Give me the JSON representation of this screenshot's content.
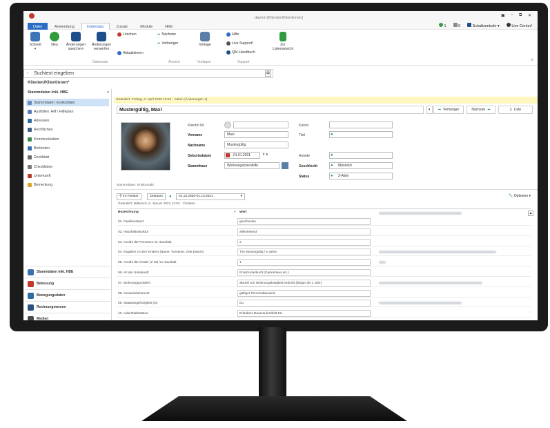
{
  "window": {
    "title": "daenin [Klienten/Klientinnen]"
  },
  "menu_tabs": [
    "Datei",
    "Anwendung",
    "Datensatz",
    "Zusatz",
    "Module",
    "Hilfe"
  ],
  "active_tab": "Datensatz",
  "top_right": {
    "count_a": "1",
    "count_b": "0",
    "schaltzentrale": "Schaltzentrale",
    "live_center": "Live Center!"
  },
  "ribbon": {
    "schnell": "Schnell",
    "neu": "Neu",
    "save": [
      "Änderungen",
      "speichern"
    ],
    "discard": [
      "Änderungen",
      "verwerfen"
    ],
    "loeschen": "Löschen",
    "aktualisieren": "Aktualisieren",
    "naechster": "Nächster",
    "vorheriger": "Vorheriger",
    "vorlage": "Vorlage",
    "hilfe": "Hilfe",
    "live_support": "Live Support!",
    "qm_handbuch": "QM-Handbuch",
    "zur_liste": [
      "Zur",
      "Listenansicht"
    ],
    "groups": {
      "datensatz": "Datensatz",
      "ansicht": "Ansicht",
      "vorlagen": "Vorlagen",
      "support": "Support"
    }
  },
  "search": {
    "text": "Suchtext eingeben"
  },
  "breadcrumb": "Klienten/Klientinnen*",
  "sidebar": {
    "header": "Stammdaten inkl. HBE",
    "items": [
      {
        "label": "Stammdaten: Erstkontakt",
        "icon": "people-icon",
        "color": "#6c8ab8"
      },
      {
        "label": "Ausfüllen: Hilf / Hilfeplan",
        "icon": "document-icon",
        "color": "#5a7fb5"
      },
      {
        "label": "Adressen",
        "icon": "address-icon",
        "color": "#2e6ca4"
      },
      {
        "label": "Rechtliches",
        "icon": "law-icon",
        "color": "#3f5f8a"
      },
      {
        "label": "Kommunikation",
        "icon": "phone-icon",
        "color": "#3b8a4a"
      },
      {
        "label": "Behörden",
        "icon": "authority-icon",
        "color": "#3a6fb0"
      },
      {
        "label": "Deckblatt",
        "icon": "sheet-icon",
        "color": "#6a6a6a"
      },
      {
        "label": "Checklisten",
        "icon": "checklist-icon",
        "color": "#7a7a7a"
      },
      {
        "label": "Unterkunft",
        "icon": "house-icon",
        "color": "#b73a2f"
      },
      {
        "label": "Bemerkung",
        "icon": "note-icon",
        "color": "#d9a52a"
      }
    ],
    "modules": [
      {
        "label": "Stammdaten inkl. HBE",
        "icon": "stammdaten-icon",
        "color": "#3a6fb0"
      },
      {
        "label": "Betreuung",
        "icon": "book-icon",
        "color": "#c0392b"
      },
      {
        "label": "Bewegungsdaten",
        "icon": "arrows-icon",
        "color": "#2e6ca4"
      },
      {
        "label": "Rechnungswesen",
        "icon": "ledger-icon",
        "color": "#2a5180"
      },
      {
        "label": "Medien",
        "icon": "media-icon",
        "color": "#4a4a4a"
      }
    ]
  },
  "record": {
    "changed_info": "Geändert: Freitag, 3. April 2020 10:22 · Admin (Änderungen 4)",
    "name": "Mustergültig, Maxi",
    "prev": "Vorheriger",
    "next": "Nächster",
    "list": "Liste",
    "labels": {
      "klientin_nr": "KlientIn Nr.",
      "vorname": "Vorname",
      "nachname": "Nachname",
      "geburtsdatum": "Geburtsdatum",
      "stammhaus": "Stammhaus",
      "kuerzel": "Kürzel",
      "titel": "Titel",
      "anrede": "Anrede",
      "geschlecht": "Geschlecht",
      "status": "Status"
    },
    "values": {
      "vorname": "Maxi",
      "nachname": "Mustergültig",
      "geburtsdatum": "01.01.2001",
      "stammhaus": "Wohnungslosenhilfe",
      "geschlecht": "Männlich",
      "status": "2-Aktiv"
    }
  },
  "erstkontakt": {
    "title": "Stammdaten: Erstkontakt",
    "im_fenster": "Im Fenster",
    "zeitraum": "Zeitraum",
    "range": "01.10.2020-01.10.2021",
    "optionen": "Optionen",
    "changed": "Geändert: Mittwoch, 6. Januar 2021 14:02 · Christen",
    "col_name": "Bezeichnung",
    "col_value": "Wert",
    "rows": [
      {
        "name": "01. Familienstand",
        "value": "geschieden"
      },
      {
        "name": "02. Haushaltsstruktur",
        "value": "alleinlebend"
      },
      {
        "name": "03. Anzahl der Personen im Haushalt",
        "value": "2"
      },
      {
        "name": "04. Angaben zu den Kindern (Name, Vorname, Geb.Datum)",
        "value": "Tim Mustergültig / 6 Jahre"
      },
      {
        "name": "05. Anzahl der Kinder (2 18) im Haushalt",
        "value": "1"
      },
      {
        "name": "06. Art der Unterkunft",
        "value": "Ersatzunterkunft (Gartenhaus etc.)"
      },
      {
        "name": "07. Wohnungsproblem",
        "value": "aktuell von Wohnungslosigkeit bedroht (länger als 1 Jahr)"
      },
      {
        "name": "08. Ausweisdokument",
        "value": "gültiger Personalausweis"
      },
      {
        "name": "09. Staatsangehörigkeit (st)",
        "value": "EU"
      },
      {
        "name": "10. Aufenthaltsstatus",
        "value": "Erlaubnis Daueraufenthalt EU"
      }
    ]
  }
}
